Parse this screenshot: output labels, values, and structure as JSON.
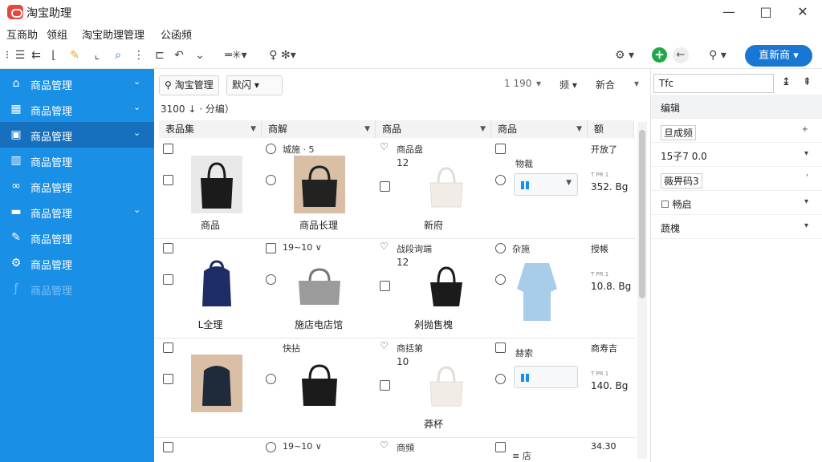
{
  "titlebar": {
    "title": "淘宝助理",
    "min": "—",
    "max": "□",
    "close": "✕"
  },
  "menu": [
    "互商助",
    "领组",
    "淘宝助理管理",
    "公函频"
  ],
  "toolbar": {
    "primary_button": "直新商 ▾"
  },
  "sidebar": {
    "items": [
      {
        "label": "商品管理",
        "chev": "⌄",
        "icon": "⌂"
      },
      {
        "label": "商品管理",
        "chev": "⌄",
        "icon": "▦"
      },
      {
        "label": "商品管理",
        "chev": "⌄",
        "icon": "▣"
      },
      {
        "label": "商品管理",
        "chev": "",
        "icon": "▥"
      },
      {
        "label": "商品管理",
        "chev": "",
        "icon": "∞"
      },
      {
        "label": "商品管理",
        "chev": "⌄",
        "icon": "▬"
      },
      {
        "label": "商品管理",
        "chev": "",
        "icon": "✎"
      },
      {
        "label": "商品管理",
        "chev": "",
        "icon": "⚙"
      },
      {
        "label": "商品管理",
        "chev": "",
        "icon": "ƒ"
      }
    ]
  },
  "main": {
    "filter1": "淘宝管理",
    "filter2": "默闪 ▾",
    "count": "1 190",
    "sort": "频 ▾",
    "new": "新合",
    "subhead": "3100 ↓ · 分编）",
    "columns": [
      "表品集",
      "商解",
      "商品",
      "商品",
      "额"
    ],
    "rows": [
      {
        "c1": {
          "cap": "商品"
        },
        "c2": {
          "lbl": "城施 · 5",
          "cap": "商品长理"
        },
        "c3": {
          "lbl": "商品盘",
          "num": "12",
          "cap": "新府"
        },
        "c4": {
          "lbl": "物裁"
        },
        "c5": {
          "lbl": "开放了",
          "tiny": "T PR 1",
          "price": "352. Bg"
        }
      },
      {
        "c1": {
          "cap": "L全理"
        },
        "c2": {
          "lbl": "19~10 ∨",
          "cap": "施店电店馆"
        },
        "c3": {
          "lbl": "战段询端",
          "num": "12",
          "cap": "剁抛售槐"
        },
        "c4": {
          "lbl": "杂施"
        },
        "c5": {
          "lbl": "授帳",
          "tiny": "T PR 1",
          "price": "10.8. Bg"
        }
      },
      {
        "c1": {
          "cap": ""
        },
        "c2": {
          "lbl": "快拈",
          "cap": ""
        },
        "c3": {
          "lbl": "商括第",
          "num": "10",
          "cap": "莽杯"
        },
        "c4": {
          "lbl": "赫索"
        },
        "c5": {
          "lbl": "商寿吉",
          "tiny": "T PR 1",
          "price": "140. Bg"
        }
      },
      {
        "c1": {
          "cap": ""
        },
        "c2": {
          "lbl": "19~10 ∨",
          "cap": ""
        },
        "c3": {
          "lbl": "商頻",
          "num": "",
          "cap": ""
        },
        "c4": {
          "lbl": "≡ 店"
        },
        "c5": {
          "lbl": "",
          "tiny": "",
          "price": "34.30"
        }
      }
    ]
  },
  "panel": {
    "search": "Tfc",
    "rows": [
      {
        "t": "编辑",
        "r": ""
      },
      {
        "t": "旦成频",
        "r": "+"
      },
      {
        "t": "15子7 0.0",
        "r": "▾"
      },
      {
        "t": "薇畀码3",
        "r": "'"
      },
      {
        "t": "☐ 畅启",
        "r": "▾"
      },
      {
        "t": "蔬槐",
        "r": "▾"
      }
    ]
  }
}
